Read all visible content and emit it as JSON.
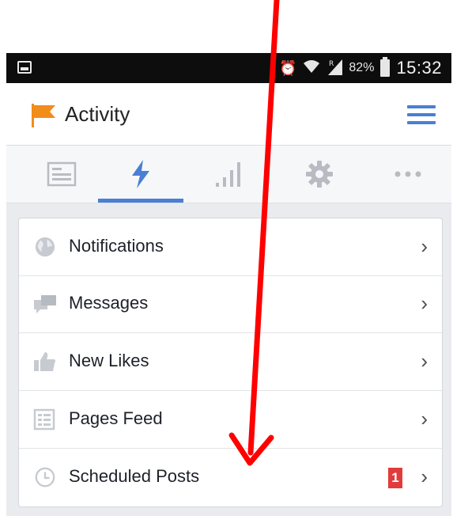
{
  "status_bar": {
    "battery_percent": "82%",
    "time": "15:32",
    "icons": [
      "image-icon",
      "alarm-icon",
      "wifi-icon",
      "roaming-signal-icon",
      "battery-icon"
    ]
  },
  "header": {
    "title": "Activity",
    "icons": [
      "flag-icon",
      "menu-icon"
    ],
    "colors": {
      "flag": "#f28c1a",
      "accent": "#4a7fd4"
    }
  },
  "tabs": [
    {
      "icon": "news-feed-icon",
      "active": false
    },
    {
      "icon": "activity-lightning-icon",
      "active": true
    },
    {
      "icon": "insights-bars-icon",
      "active": false
    },
    {
      "icon": "settings-gear-icon",
      "active": false
    },
    {
      "icon": "more-dots-icon",
      "active": false
    }
  ],
  "list": {
    "items": [
      {
        "label": "Notifications",
        "icon": "globe-icon"
      },
      {
        "label": "Messages",
        "icon": "messages-icon"
      },
      {
        "label": "New Likes",
        "icon": "thumbs-up-icon"
      },
      {
        "label": "Pages Feed",
        "icon": "pages-feed-icon"
      },
      {
        "label": "Scheduled Posts",
        "icon": "clock-icon",
        "badge": "1"
      }
    ]
  },
  "annotation": {
    "color": "#ff0000",
    "icon": "red-arrow-annotation"
  }
}
